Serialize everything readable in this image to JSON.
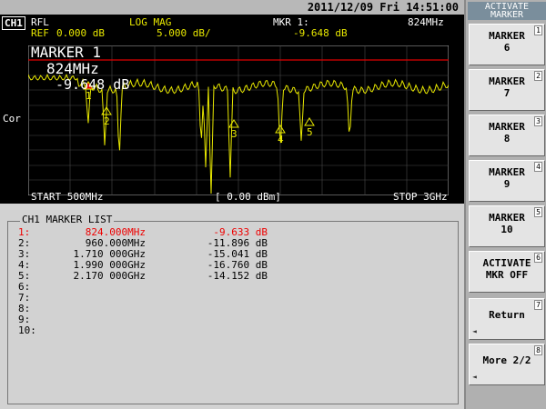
{
  "datetime": "2011/12/09 Fri 14:51:00",
  "header": {
    "channel": "CH1",
    "format": "RFL",
    "scale_type": "LOG MAG",
    "marker_label": "MKR 1:",
    "marker_freq": "824MHz",
    "ref": "REF",
    "ref_value": "0.000 dB",
    "scale": "5.000 dB/",
    "marker_value": "-9.648 dB"
  },
  "plot": {
    "marker_title": "MARKER 1",
    "marker_freq": "824MHz",
    "marker_value": "-9.648 dB",
    "marker_ids": [
      "1",
      "2",
      "3",
      "4",
      "5"
    ],
    "correction": "Cor",
    "trace_color": "#e8e800",
    "ref_line_color": "#e00000"
  },
  "footer": {
    "start": "START 500MHz",
    "power": "[ 0.00 dBm]",
    "stop": "STOP 3GHz"
  },
  "marker_list": {
    "title": "CH1 MARKER LIST",
    "rows": [
      {
        "idx": "1:",
        "freq": "824.000MHz",
        "level": "-9.633 dB",
        "active": true
      },
      {
        "idx": "2:",
        "freq": "960.000MHz",
        "level": "-11.896 dB",
        "active": false
      },
      {
        "idx": "3:",
        "freq": "1.710 000GHz",
        "level": "-15.041 dB",
        "active": false
      },
      {
        "idx": "4:",
        "freq": "1.990 000GHz",
        "level": "-16.760 dB",
        "active": false
      },
      {
        "idx": "5:",
        "freq": "2.170 000GHz",
        "level": "-14.152 dB",
        "active": false
      },
      {
        "idx": "6:",
        "freq": "",
        "level": "",
        "active": false
      },
      {
        "idx": "7:",
        "freq": "",
        "level": "",
        "active": false
      },
      {
        "idx": "8:",
        "freq": "",
        "level": "",
        "active": false
      },
      {
        "idx": "9:",
        "freq": "",
        "level": "",
        "active": false
      },
      {
        "idx": "10:",
        "freq": "",
        "level": "",
        "active": false
      }
    ]
  },
  "softkeys": {
    "title": "ACTIVATE\nMARKER",
    "keys": [
      {
        "label": "MARKER\n6",
        "num": "1"
      },
      {
        "label": "MARKER\n7",
        "num": "2"
      },
      {
        "label": "MARKER\n8",
        "num": "3"
      },
      {
        "label": "MARKER\n9",
        "num": "4"
      },
      {
        "label": "MARKER\n10",
        "num": "5"
      },
      {
        "label": "ACTIVATE\nMKR OFF",
        "num": "6"
      },
      {
        "label": "Return",
        "num": "7"
      },
      {
        "label": "More 2/2",
        "num": "8"
      }
    ]
  }
}
